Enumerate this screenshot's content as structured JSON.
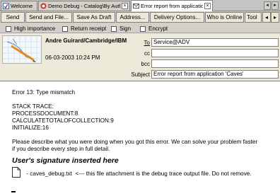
{
  "tabs": [
    {
      "label": "Welcome",
      "icon": "welcome-icon",
      "active": false
    },
    {
      "label": "Demo Debug - Catalog\\By Autho...",
      "icon": "database-icon",
      "active": false
    },
    {
      "label": "Error report from application...",
      "icon": "memo-icon",
      "active": true
    }
  ],
  "actions": {
    "send": "Send",
    "send_file": "Send and File...",
    "save_draft": "Save As Draft",
    "address": "Address...",
    "delivery": "Delivery Options...",
    "who_online": "Who is Online",
    "tools": "Tool"
  },
  "options": {
    "high_importance": "High importance",
    "return_receipt": "Return receipt",
    "sign": "Sign",
    "encrypt": "Encrypt"
  },
  "header": {
    "author": "Andre Guirard/Cambridge/IBM",
    "date": "06-03-2003 10:24 PM",
    "to_label": "To",
    "to_value": "Service@ADV",
    "cc_label": "cc",
    "cc_value": "",
    "bcc_label": "bcc",
    "bcc_value": "",
    "subject_label": "Subject",
    "subject_value": "Error report from application 'Caves'"
  },
  "body": {
    "error_line": "Error 13: Type mismatch",
    "stack_title": "STACK TRACE:",
    "stack": [
      "PROCESSDOCUMENT:8",
      "CALCULATETOTALOFCOLLECTION:9",
      "INITIALIZE:16"
    ],
    "instructions_1": "Please describe what you were doing when you got this error. We can solve your problem faster",
    "instructions_2": "if you describe every step in full detail.",
    "signature": "User's signature inserted here",
    "attachment_text": " - caves_debug.txt  <--- this file attachment is the debug trace output file. Do not remove."
  }
}
